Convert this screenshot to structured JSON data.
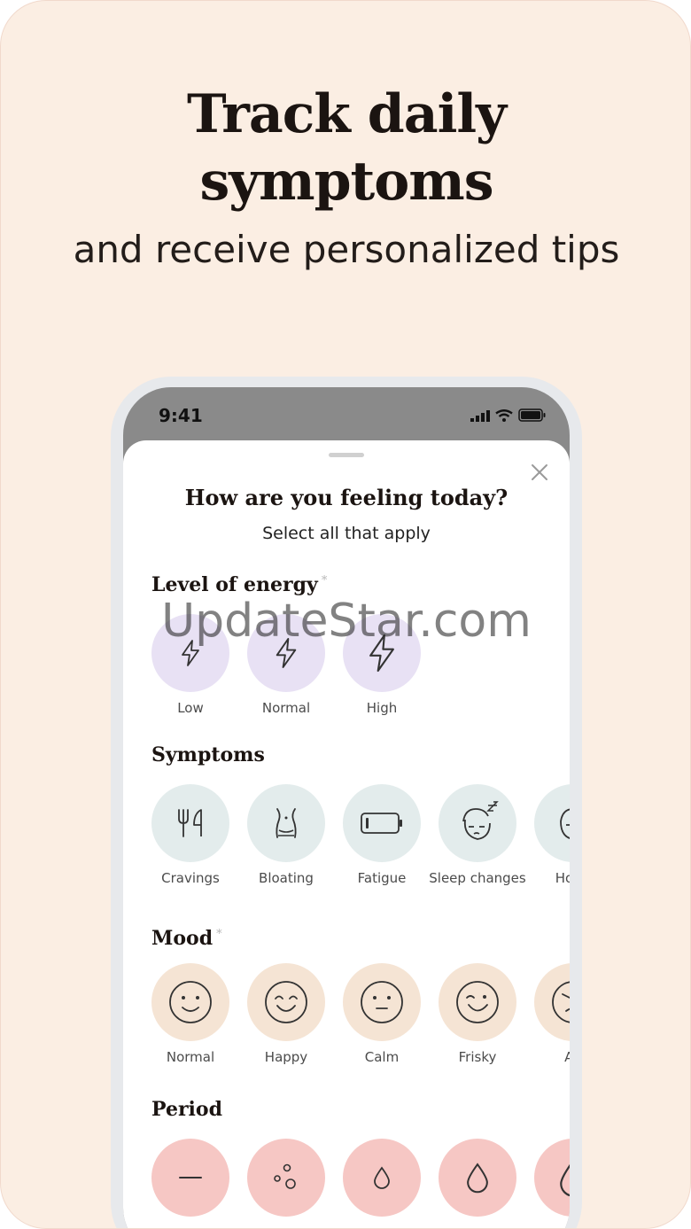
{
  "promo": {
    "headline_line1": "Track daily",
    "headline_line2": "symptoms",
    "subheadline": "and receive personalized tips"
  },
  "status_bar": {
    "time": "9:41",
    "icons": [
      "signal-icon",
      "wifi-icon",
      "battery-icon"
    ]
  },
  "sheet": {
    "title": "How are you feeling today?",
    "subtitle": "Select all that apply",
    "close_icon": "close-icon"
  },
  "sections": {
    "energy": {
      "title": "Level of energy",
      "required_mark": "*",
      "options": [
        {
          "label": "Low",
          "icon": "lightning-small-icon"
        },
        {
          "label": "Normal",
          "icon": "lightning-medium-icon"
        },
        {
          "label": "High",
          "icon": "lightning-large-icon"
        }
      ]
    },
    "symptoms": {
      "title": "Symptoms",
      "options": [
        {
          "label": "Cravings",
          "icon": "fork-knife-icon"
        },
        {
          "label": "Bloating",
          "icon": "belly-icon"
        },
        {
          "label": "Fatigue",
          "icon": "low-battery-icon"
        },
        {
          "label": "Sleep changes",
          "icon": "sleepy-face-icon"
        },
        {
          "label": "Hot fl",
          "icon": "hot-face-icon"
        }
      ]
    },
    "mood": {
      "title": "Mood",
      "required_mark": "*",
      "options": [
        {
          "label": "Normal",
          "icon": "smile-face-icon"
        },
        {
          "label": "Happy",
          "icon": "happy-face-icon"
        },
        {
          "label": "Calm",
          "icon": "neutral-face-icon"
        },
        {
          "label": "Frisky",
          "icon": "wink-face-icon"
        },
        {
          "label": "An",
          "icon": "angry-face-icon"
        }
      ]
    },
    "period": {
      "title": "Period",
      "options": [
        {
          "label": "",
          "icon": "dash-icon"
        },
        {
          "label": "",
          "icon": "spotting-dots-icon"
        },
        {
          "label": "",
          "icon": "drop-small-icon"
        },
        {
          "label": "",
          "icon": "drop-medium-icon"
        },
        {
          "label": "",
          "icon": "drop-large-icon"
        }
      ]
    }
  },
  "watermark": "UpdateStar.com",
  "colors": {
    "background": "#fbeee3",
    "energy_circle": "#e8e1f4",
    "symptom_circle": "#e3ecec",
    "mood_circle": "#f5e4d4",
    "period_circle": "#f6c7c4"
  }
}
